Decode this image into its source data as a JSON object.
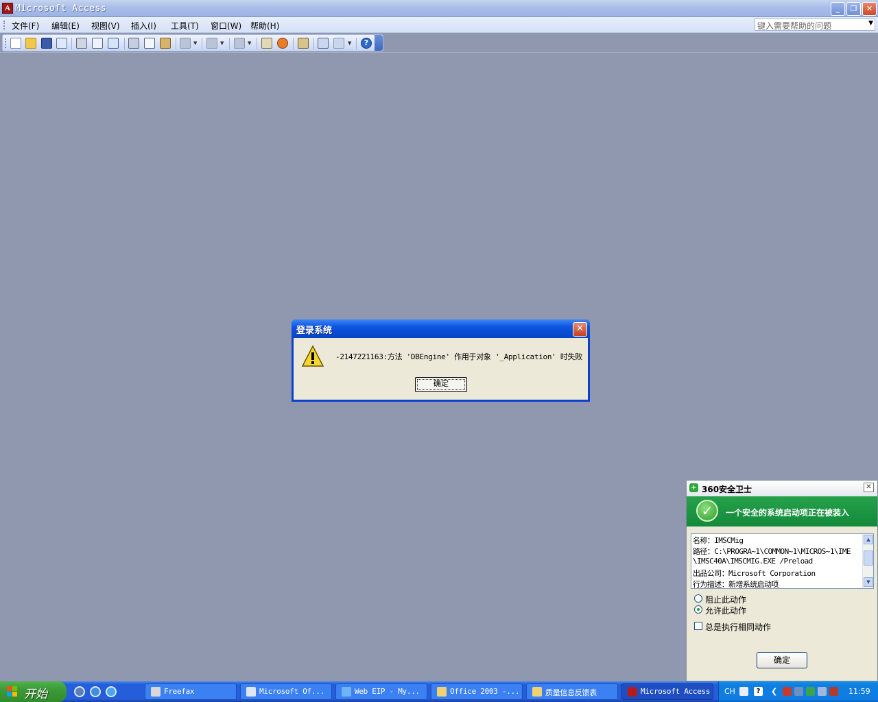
{
  "window": {
    "title": "Microsoft Access"
  },
  "menubar": {
    "items": [
      {
        "label": "文件(F)"
      },
      {
        "label": "编辑(E)"
      },
      {
        "label": "视图(V)"
      },
      {
        "label": "插入(I)"
      },
      {
        "label": "工具(T)"
      },
      {
        "label": "窗口(W)"
      },
      {
        "label": "帮助(H)"
      }
    ],
    "help_placeholder": "键入需要帮助的问题"
  },
  "toolbar": {
    "icons": [
      "new-icon",
      "open-icon",
      "save-icon",
      "file-search-icon",
      "print-icon",
      "print-preview-icon",
      "spelling-icon",
      "cut-icon",
      "copy-icon",
      "paste-icon",
      "undo-icon",
      "office-links-icon",
      "analyze-icon",
      "code-icon",
      "relationships-icon",
      "properties-icon",
      "new-object-icon",
      "new-object-dropdown-icon",
      "help-icon"
    ]
  },
  "dialog": {
    "title": "登录系统",
    "message": "-2147221163:方法 'DBEngine' 作用于对象 '_Application' 时失败",
    "ok_label": "确定"
  },
  "popup360": {
    "title": "360安全卫士",
    "banner": "一个安全的系统启动项正在被装入",
    "details": [
      "名称：IMSCMig",
      "路径：C:\\PROGRA~1\\COMMON~1\\MICROS~1\\IME",
      "\\IMSC40A\\IMSCMIG.EXE /Preload",
      "出品公司：Microsoft Corporation",
      "行为描述：新增系统启动项"
    ],
    "option_block": "阻止此动作",
    "option_allow": "允许此动作",
    "option_selected": "allow",
    "always_label": "总是执行相同动作",
    "always_checked": false,
    "ok_label": "确定"
  },
  "taskbar": {
    "start_label": "开始",
    "tasks": [
      {
        "label": "Freefax"
      },
      {
        "label": "Microsoft Of..."
      },
      {
        "label": "Web EIP - My..."
      },
      {
        "label": "Office 2003 -..."
      },
      {
        "label": "质量信息反馈表"
      },
      {
        "label": "Microsoft Access",
        "active": true
      }
    ],
    "language": "CH",
    "clock": "11:59"
  },
  "colors": {
    "workspace": "#8f98ae",
    "dialog_title": "#0d55df",
    "popup_banner": "#1f9a47",
    "taskbar": "#245edb",
    "start_button": "#3c9a38"
  }
}
